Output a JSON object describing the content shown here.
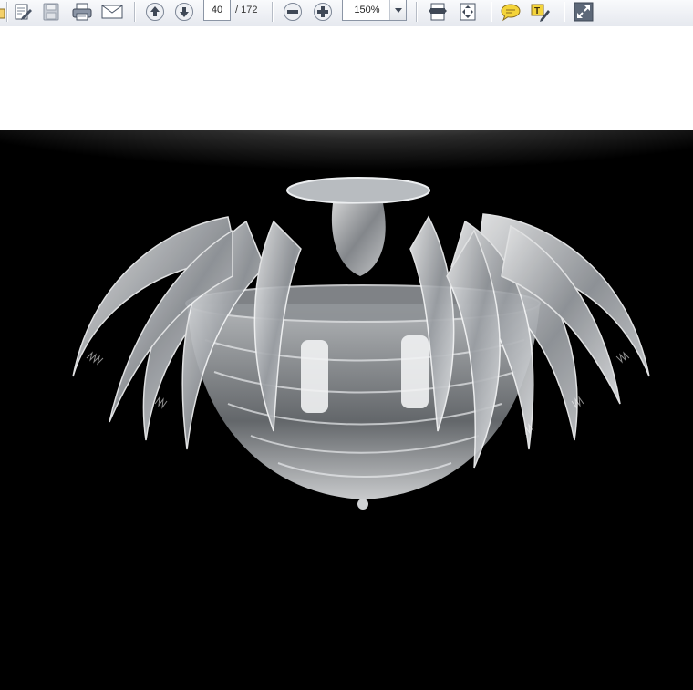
{
  "toolbar": {
    "page_number": "40",
    "page_total_label": "/ 172",
    "zoom_value": "150%",
    "buttons": [
      {
        "name": "open-folder-button",
        "icon": "folder-icon"
      },
      {
        "name": "edit-button",
        "icon": "edit-icon"
      },
      {
        "name": "save-button",
        "icon": "save-icon"
      },
      {
        "name": "print-button",
        "icon": "printer-icon"
      },
      {
        "name": "email-button",
        "icon": "envelope-icon"
      },
      {
        "name": "previous-page-button",
        "icon": "arrow-up-icon"
      },
      {
        "name": "next-page-button",
        "icon": "arrow-down-icon"
      },
      {
        "name": "zoom-out-button",
        "icon": "minus-circle-icon"
      },
      {
        "name": "zoom-in-button",
        "icon": "plus-circle-icon"
      },
      {
        "name": "fit-width-button",
        "icon": "fit-width-icon"
      },
      {
        "name": "fit-page-button",
        "icon": "fit-page-icon"
      },
      {
        "name": "comment-button",
        "icon": "speech-bubble-icon"
      },
      {
        "name": "highlight-text-button",
        "icon": "text-highlight-icon"
      },
      {
        "name": "full-screen-button",
        "icon": "expand-icon"
      }
    ]
  },
  "document": {
    "image": {
      "subject": "chandelier-photo",
      "background_color": "#000000"
    }
  },
  "colors": {
    "toolbar_top": "#f9fafc",
    "toolbar_bottom": "#e6e9ef",
    "icon_blue": "#3b5d8f",
    "icon_yellow": "#f4d43a"
  }
}
